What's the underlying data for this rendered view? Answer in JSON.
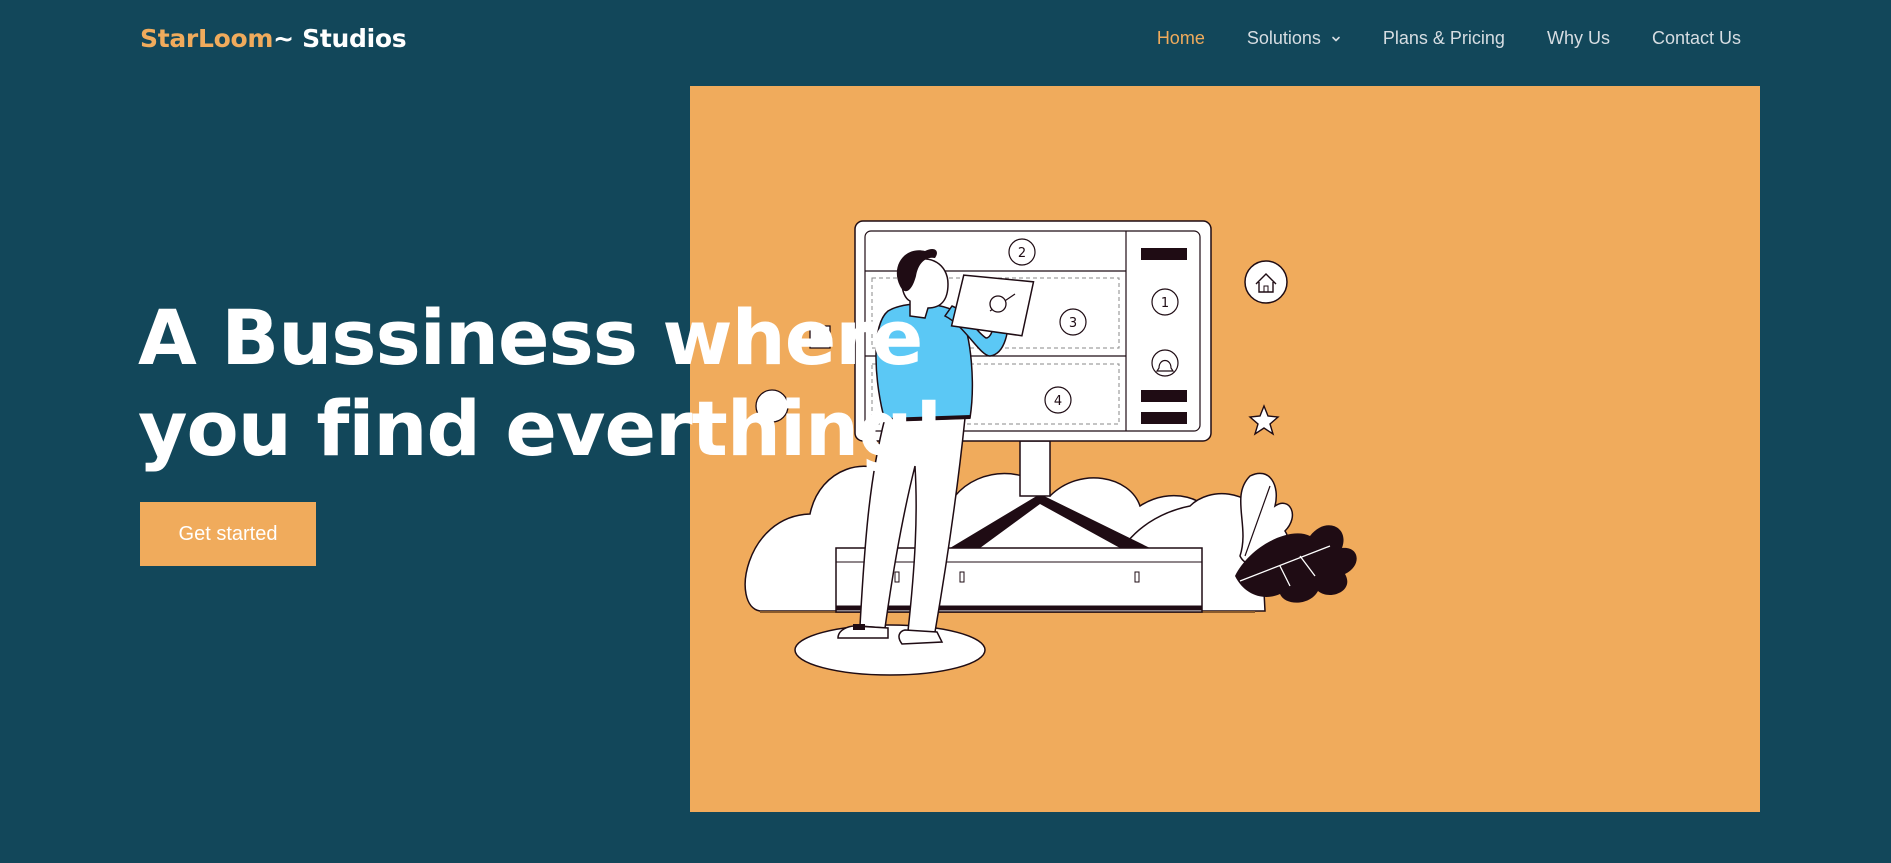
{
  "brand": {
    "part1": "StarLoom",
    "part2": "~ Studios"
  },
  "nav": {
    "items": [
      {
        "label": "Home",
        "active": true
      },
      {
        "label": "Solutions",
        "dropdown": true
      },
      {
        "label": "Plans & Pricing"
      },
      {
        "label": "Why Us"
      },
      {
        "label": "Contact Us"
      }
    ]
  },
  "hero": {
    "headline_line1": "A Bussiness where",
    "headline_line2": "you find everthing!",
    "cta_label": "Get started",
    "illustration": {
      "board_numbers": [
        "1",
        "2",
        "3",
        "4"
      ],
      "icons": [
        "home-icon",
        "bell-icon",
        "star-icon"
      ]
    }
  },
  "colors": {
    "background": "#12475a",
    "accent": "#f0ab5c",
    "shirt": "#5bc8f5",
    "ink": "#1f0c14"
  }
}
